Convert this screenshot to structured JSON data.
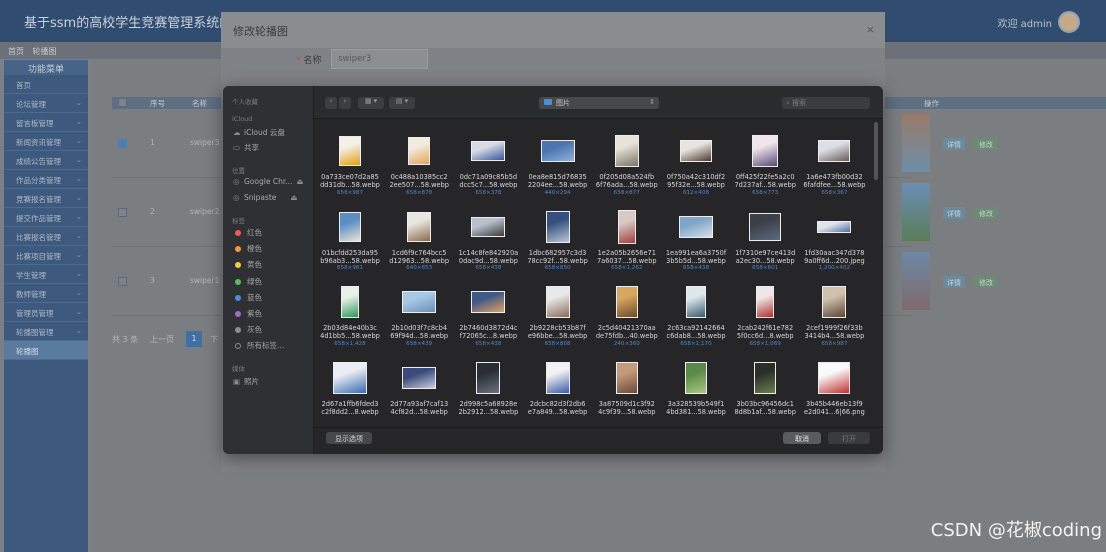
{
  "app": {
    "title": "基于ssm的高校学生竞赛管理系统的设",
    "welcome": "欢迎 admin"
  },
  "breadcrumb": [
    "首页",
    "轮播图"
  ],
  "sidebar": {
    "header": "功能菜单",
    "items": [
      "首页",
      "论坛管理",
      "留言板管理",
      "新闻资讯管理",
      "成绩公告管理",
      "作品分类管理",
      "竞赛报名管理",
      "提交作品管理",
      "比赛报名管理",
      "比赛项目管理",
      "学生管理",
      "教师管理",
      "管理员管理",
      "轮播图管理",
      "轮播图"
    ]
  },
  "table": {
    "headers": [
      "序号",
      "名称",
      "操作"
    ],
    "rows": [
      {
        "index": "1",
        "name": "swiper3",
        "checked": true
      },
      {
        "index": "2",
        "name": "swiper2",
        "checked": false
      },
      {
        "index": "3",
        "name": "swiper1",
        "checked": false
      }
    ],
    "detail_label": "详情",
    "edit_label": "修改"
  },
  "pager": {
    "total": "共 3 条",
    "prev": "上一页",
    "page": "1",
    "next_partial": "下"
  },
  "modal": {
    "title": "修改轮播图",
    "name_label": "名称",
    "name_value": "swiper3",
    "close": "×"
  },
  "picker": {
    "sections": {
      "personal": "个人收藏",
      "icloud": "iCloud",
      "locations": "位置",
      "tags": "标签",
      "media": "媒体"
    },
    "icloud_items": [
      "iCloud 云盘",
      "共享"
    ],
    "locations": [
      "Google Chr...",
      "Snipaste"
    ],
    "tags": [
      {
        "label": "红色",
        "color": "#ea5f55"
      },
      {
        "label": "橙色",
        "color": "#f09a3d"
      },
      {
        "label": "黄色",
        "color": "#e9cc4a"
      },
      {
        "label": "绿色",
        "color": "#5bbd58"
      },
      {
        "label": "蓝色",
        "color": "#4c8ed6"
      },
      {
        "label": "紫色",
        "color": "#a168c6"
      },
      {
        "label": "灰色",
        "color": "#8e8e92"
      },
      {
        "label": "所有标签...",
        "color": ""
      }
    ],
    "media_items": [
      "照片"
    ],
    "location": "图片",
    "search_placeholder": "搜索",
    "show_options": "显示选项",
    "cancel": "取消",
    "open": "打开",
    "files": [
      {
        "n1": "0a733ce07d2a85",
        "n2": "dd31db...58.webp",
        "s": "658×987"
      },
      {
        "n1": "0c488a10385cc2",
        "n2": "2ee507...58.webp",
        "s": "658×878"
      },
      {
        "n1": "0dc71a09c85b5d",
        "n2": "dcc5c7...58.webp",
        "s": "658×378"
      },
      {
        "n1": "0ea8e815d76835",
        "n2": "2204ee...58.webp",
        "s": "440×294"
      },
      {
        "n1": "0f205d08a524fb",
        "n2": "6f76ada...58.webp",
        "s": "658×877"
      },
      {
        "n1": "0f750a42c310df2",
        "n2": "95f32e...58.webp",
        "s": "612×408"
      },
      {
        "n1": "0ff425f22fe5a2c0",
        "n2": "7d237af...58.webp",
        "s": "658×773"
      },
      {
        "n1": "1a6e473fb00d32",
        "n2": "6fafdfee...58.webp",
        "s": "658×367"
      },
      {
        "n1": "01bcfdd253da95",
        "n2": "b96ab3...58.webp",
        "s": "658×981"
      },
      {
        "n1": "1cd6f9c764bcc5",
        "n2": "d12963...58.webp",
        "s": "640×853"
      },
      {
        "n1": "1c14c8fe842920a",
        "n2": "0dac9d...58.webp",
        "s": "658×438"
      },
      {
        "n1": "1dbc682957c3d3",
        "n2": "78cc92f...58.webp",
        "s": "658×850"
      },
      {
        "n1": "1e2a05b2656e71",
        "n2": "7a6037...58.webp",
        "s": "658×1,262"
      },
      {
        "n1": "1ea991ea6a3750f",
        "n2": "3b5b5d...58.webp",
        "s": "658×438"
      },
      {
        "n1": "1f7310e97ce413d",
        "n2": "a2ec30...58.webp",
        "s": "658×601"
      },
      {
        "n1": "1fd30aac347d378",
        "n2": "9a0ff6d...200.jpeg",
        "s": "1,200×402"
      },
      {
        "n1": "2b03d84e40b3c",
        "n2": "4d1bb5...58.webp",
        "s": "658×1,428"
      },
      {
        "n1": "2b10d03f7c8cb4",
        "n2": "69f94d...58.webp",
        "s": "658×439"
      },
      {
        "n1": "2b7460d3872d4c",
        "n2": "f72065c...8.webp",
        "s": "658×438"
      },
      {
        "n1": "2b9228cb53b87f",
        "n2": "e96bbe...58.webp",
        "s": "658×808"
      },
      {
        "n1": "2c5d40421370aa",
        "n2": "de75fdb...40.webp",
        "s": "240×360"
      },
      {
        "n1": "2c63ca92142664",
        "n2": "c6dab8...58.webp",
        "s": "658×1,170"
      },
      {
        "n1": "2cab242f61e782",
        "n2": "5f0cc6d...8.webp",
        "s": "658×1,069"
      },
      {
        "n1": "2cef1999f26f33b",
        "n2": "3414b4...58.webp",
        "s": "658×987"
      },
      {
        "n1": "2d67a1ffb6fded3",
        "n2": "c2f8dd2...8.webp",
        "s": ""
      },
      {
        "n1": "2d77a93af7caf13",
        "n2": "4cf82d...58.webp",
        "s": ""
      },
      {
        "n1": "2d998c5a68928e",
        "n2": "2b2912...58.webp",
        "s": ""
      },
      {
        "n1": "2dcbc82d3f2db6",
        "n2": "e7a849...58.webp",
        "s": ""
      },
      {
        "n1": "3a87509d1c3f92",
        "n2": "4c9f39...58.webp",
        "s": ""
      },
      {
        "n1": "3a328539b549f1",
        "n2": "4bd381...58.webp",
        "s": ""
      },
      {
        "n1": "3b03bc96456dc1",
        "n2": "8d8b1af...58.webp",
        "s": ""
      },
      {
        "n1": "3b45b446eb13f9",
        "n2": "e2d041...6|66.png",
        "s": ""
      }
    ]
  },
  "watermark": "CSDN @花椒coding"
}
